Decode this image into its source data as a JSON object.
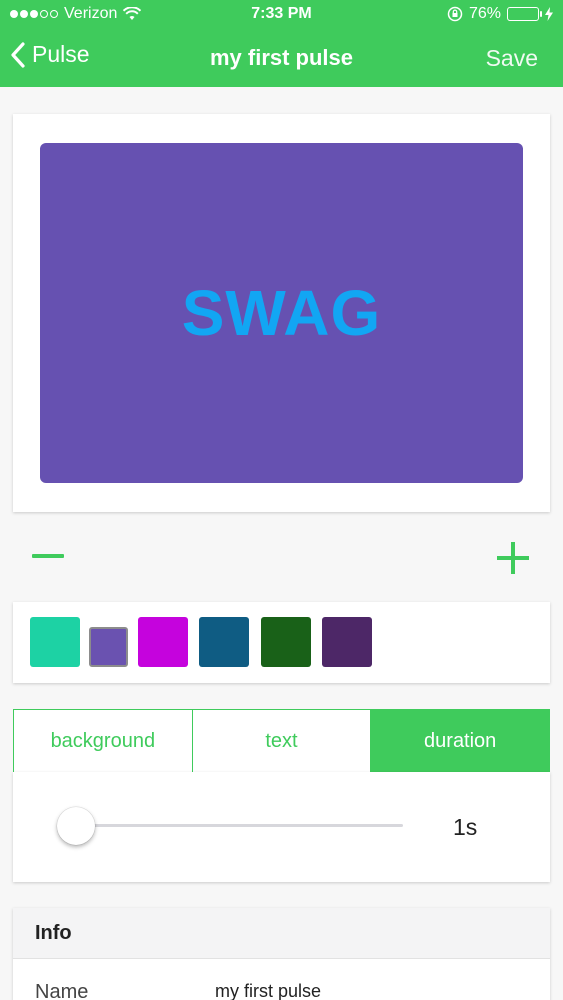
{
  "status_bar": {
    "carrier": "Verizon",
    "time": "7:33 PM",
    "battery_percent": "76%",
    "battery_level": 0.76
  },
  "nav": {
    "back_label": "Pulse",
    "title": "my first pulse",
    "save_label": "Save"
  },
  "preview": {
    "text": "SWAG",
    "background_color": "#6651b1",
    "text_color": "#12a6f3"
  },
  "swatches": [
    {
      "color": "#1dd2a4",
      "selected": false
    },
    {
      "color": "#6a52b0",
      "selected": true
    },
    {
      "color": "#c503dd",
      "selected": false
    },
    {
      "color": "#0f5c83",
      "selected": false
    },
    {
      "color": "#196118",
      "selected": false
    },
    {
      "color": "#4d2767",
      "selected": false
    }
  ],
  "tabs": [
    {
      "label": "background",
      "active": false
    },
    {
      "label": "text",
      "active": false
    },
    {
      "label": "duration",
      "active": true
    }
  ],
  "duration": {
    "value_label": "1s",
    "slider_fraction": 0
  },
  "info": {
    "header": "Info",
    "rows": [
      {
        "label": "Name",
        "value": "my first pulse"
      }
    ]
  },
  "colors": {
    "accent": "#3fcb5c"
  }
}
